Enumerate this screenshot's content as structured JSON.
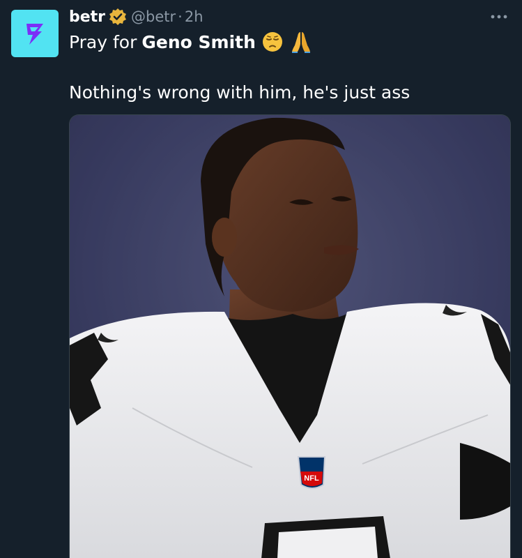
{
  "tweet": {
    "display_name": "betr",
    "handle": "@betr",
    "separator": "·",
    "time": "2h",
    "text_prefix": "Pray for",
    "text_bold": "Geno Smith",
    "text_line2": "Nothing's wrong with him, he's just ass",
    "emojis": [
      "pensive-face-icon",
      "folded-hands-icon"
    ]
  },
  "media": {
    "jersey_badge": "NFL"
  },
  "colors": {
    "background": "#15202b",
    "avatar": "#52e3f2",
    "logo": "#7b2ff7",
    "verified_badge": "#e8b53d",
    "secondary_text": "#8b98a5"
  }
}
